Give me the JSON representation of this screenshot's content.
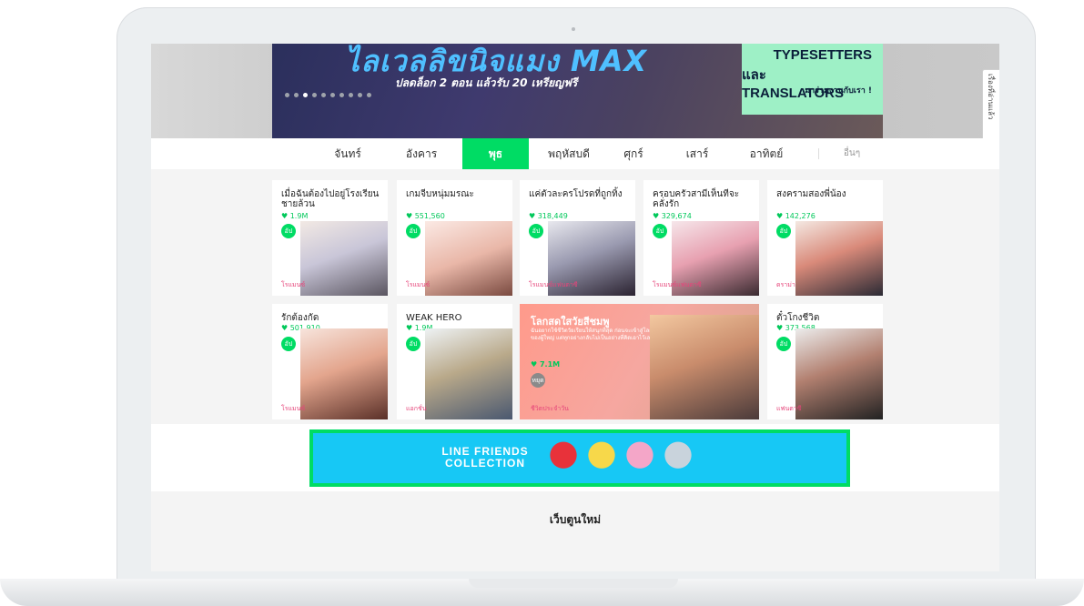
{
  "banner": {
    "title": "ไลเวลลิขนิจแมง MAX",
    "subtitle": "ปลดล็อก 2 ตอน แล้วรับ 20 เหรียญฟรี",
    "right_line1": "TYPESETTERS",
    "right_line2": "และ TRANSLATORS",
    "right_line3": "มาร่วมงานกับเรา !",
    "slide_count": 10,
    "active_slide": 2
  },
  "side_tab": {
    "label": "เรื่องที่อ่านแล้ว",
    "arrow": "‹"
  },
  "days": [
    "จันทร์",
    "อังคาร",
    "พุธ",
    "พฤหัสบดี",
    "ศุกร์",
    "เสาร์",
    "อาทิตย์"
  ],
  "active_day": "พุธ",
  "more_label": "อื่นๆ",
  "cards_row1": [
    {
      "title": "เมื่อฉันต้องไปอยู่โรงเรียนชายล้วน",
      "likes": "♥ 1.9M",
      "badge": "อัป",
      "genre": "โรแมนซ์"
    },
    {
      "title": "เกมจีบหนุ่มมรณะ",
      "likes": "♥ 551,560",
      "badge": "อัป",
      "genre": "โรแมนซ์"
    },
    {
      "title": "แค่ตัวละครโปรดที่ถูกทิ้ง",
      "likes": "♥ 318,449",
      "badge": "อัป",
      "genre": "โรแมนซ์แฟนตาซี"
    },
    {
      "title": "ครอบครัวสามีเห็นทีจะคลั่งรัก",
      "likes": "♥ 329,674",
      "badge": "อัป",
      "genre": "โรแมนซ์แฟนตาซี"
    },
    {
      "title": "สงครามสองพี่น้อง",
      "likes": "♥ 142,276",
      "badge": "อัป",
      "genre": "ดราม่า"
    }
  ],
  "cards_row2": [
    {
      "title": "รักต้องกัด",
      "likes": "♥ 501,910",
      "badge": "อัป",
      "genre": "โรแมนซ์"
    },
    {
      "title": "WEAK HERO",
      "likes": "♥ 1.9M",
      "badge": "อัป",
      "genre": "แอกชั่น"
    },
    {
      "title": "ตั๋วโกงชีวิต",
      "likes": "♥ 373,568",
      "badge": "อัป",
      "genre": "แฟนตาซี"
    }
  ],
  "wide_card": {
    "title": "โลกสดใสวัยสีชมพู",
    "description": "ฉันอยากใช้ชีวิตวัยเรียนให้สนุกที่สุด ก่อนจะเข้าสู่โลกของผู้ใหญ่ แต่ทุกอย่างกลับไม่เป็นอย่างที่คิดเอาไว้เลย",
    "likes": "♥ 7.1M",
    "badge": "หยุด",
    "genre": "ชีวิตประจำวัน"
  },
  "ad": {
    "line1": "LINE FRIENDS",
    "line2": "COLLECTION"
  },
  "new_section_title": "เว็บตูนใหม่",
  "colors": {
    "accent": "#00dc64",
    "ad_bg": "#17c8f5"
  }
}
